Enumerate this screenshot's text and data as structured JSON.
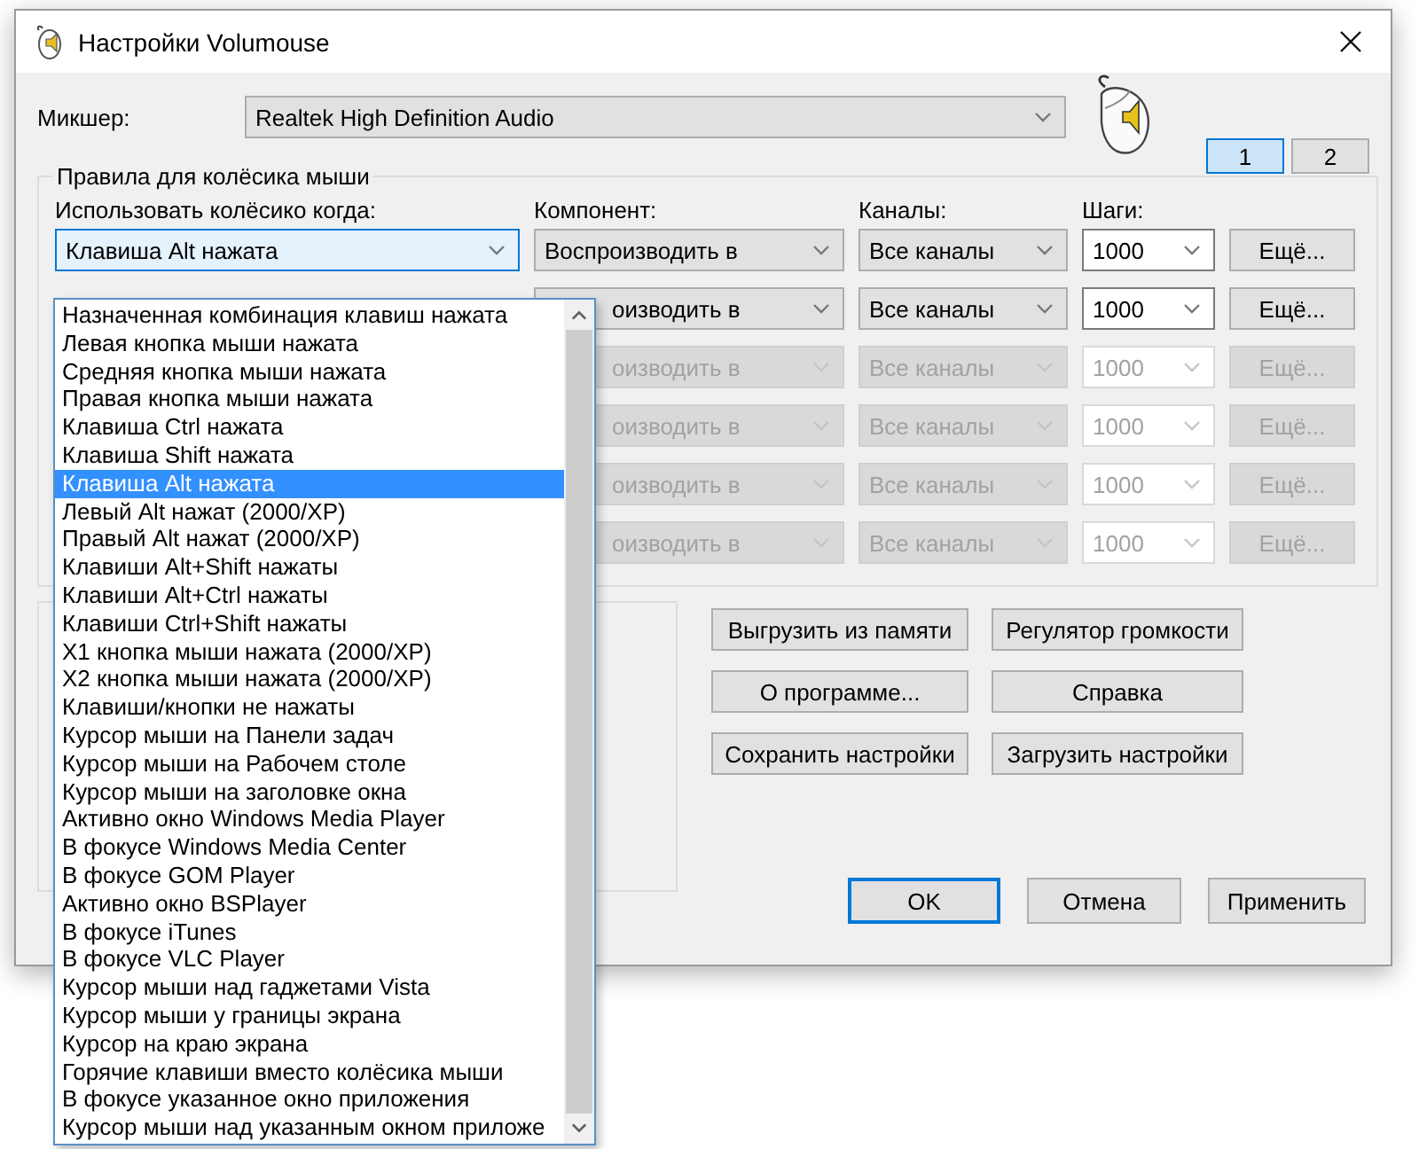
{
  "window": {
    "title": "Настройки Volumouse"
  },
  "mixer": {
    "label": "Микшер:",
    "value": "Realtek High Definition Audio"
  },
  "tabs": [
    {
      "label": "1",
      "selected": true
    },
    {
      "label": "2",
      "selected": false
    }
  ],
  "rules_group": {
    "title": "Правила для колёсика мыши",
    "columns": [
      "Использовать колёсико когда:",
      "Компонент:",
      "Каналы:",
      "Шаги:"
    ],
    "rows": [
      {
        "condition": "Клавиша Alt нажата",
        "component": "Воспроизводить в",
        "channels": "Все каналы",
        "steps": "1000",
        "more": "Ещё...",
        "disabled": false
      },
      {
        "component": "оизводить в",
        "channels": "Все каналы",
        "steps": "1000",
        "more": "Ещё...",
        "disabled": false
      },
      {
        "component": "оизводить в",
        "channels": "Все каналы",
        "steps": "1000",
        "more": "Ещё...",
        "disabled": true
      },
      {
        "component": "оизводить в",
        "channels": "Все каналы",
        "steps": "1000",
        "more": "Ещё...",
        "disabled": true
      },
      {
        "component": "оизводить в",
        "channels": "Все каналы",
        "steps": "1000",
        "more": "Ещё...",
        "disabled": true
      },
      {
        "component": "оизводить в",
        "channels": "Все каналы",
        "steps": "1000",
        "more": "Ещё...",
        "disabled": true
      }
    ]
  },
  "actions": [
    "Выгрузить из памяти",
    "Регулятор громкости",
    "О программе...",
    "Справка",
    "Сохранить настройки",
    "Загрузить настройки"
  ],
  "dialog_buttons": [
    {
      "label": "OK",
      "default": true
    },
    {
      "label": "Отмена",
      "default": false
    },
    {
      "label": "Применить",
      "default": false
    }
  ],
  "dropdown": {
    "items": [
      {
        "label": "Назначенная комбинация клавиш нажата",
        "selected": false
      },
      {
        "label": "Левая кнопка мыши нажата",
        "selected": false
      },
      {
        "label": "Средняя кнопка мыши нажата",
        "selected": false
      },
      {
        "label": "Правая кнопка мыши нажата",
        "selected": false
      },
      {
        "label": "Клавиша Ctrl нажата",
        "selected": false
      },
      {
        "label": "Клавиша Shift нажата",
        "selected": false
      },
      {
        "label": "Клавиша Alt нажата",
        "selected": true
      },
      {
        "label": "Левый Alt нажат (2000/XP)",
        "selected": false
      },
      {
        "label": "Правый Alt нажат (2000/XP)",
        "selected": false
      },
      {
        "label": "Клавиши Alt+Shift нажаты",
        "selected": false
      },
      {
        "label": "Клавиши Alt+Ctrl нажаты",
        "selected": false
      },
      {
        "label": "Клавиши Ctrl+Shift нажаты",
        "selected": false
      },
      {
        "label": "X1 кнопка мыши нажата (2000/XP)",
        "selected": false
      },
      {
        "label": "X2 кнопка мыши нажата (2000/XP)",
        "selected": false
      },
      {
        "label": "Клавиши/кнопки не нажаты",
        "selected": false
      },
      {
        "label": "Курсор мыши на Панели задач",
        "selected": false
      },
      {
        "label": "Курсор мыши на Рабочем столе",
        "selected": false
      },
      {
        "label": "Курсор мыши на заголовке окна",
        "selected": false
      },
      {
        "label": "Активно окно Windows Media Player",
        "selected": false
      },
      {
        "label": "В фокусе Windows Media Center",
        "selected": false
      },
      {
        "label": "В фокусе GOM Player",
        "selected": false
      },
      {
        "label": "Активно окно BSPlayer",
        "selected": false
      },
      {
        "label": "В фокусе iTunes",
        "selected": false
      },
      {
        "label": "В фокусе VLC Player",
        "selected": false
      },
      {
        "label": "Курсор мыши над гаджетами Vista",
        "selected": false
      },
      {
        "label": "Курсор мыши у границы экрана",
        "selected": false
      },
      {
        "label": "Курсор на краю экрана",
        "selected": false
      },
      {
        "label": "Горячие клавиши вместо колёсика мыши",
        "selected": false
      },
      {
        "label": "В фокусе указанное окно приложения",
        "selected": false
      },
      {
        "label": "Курсор мыши над указанным окном приложе",
        "selected": false
      }
    ]
  }
}
